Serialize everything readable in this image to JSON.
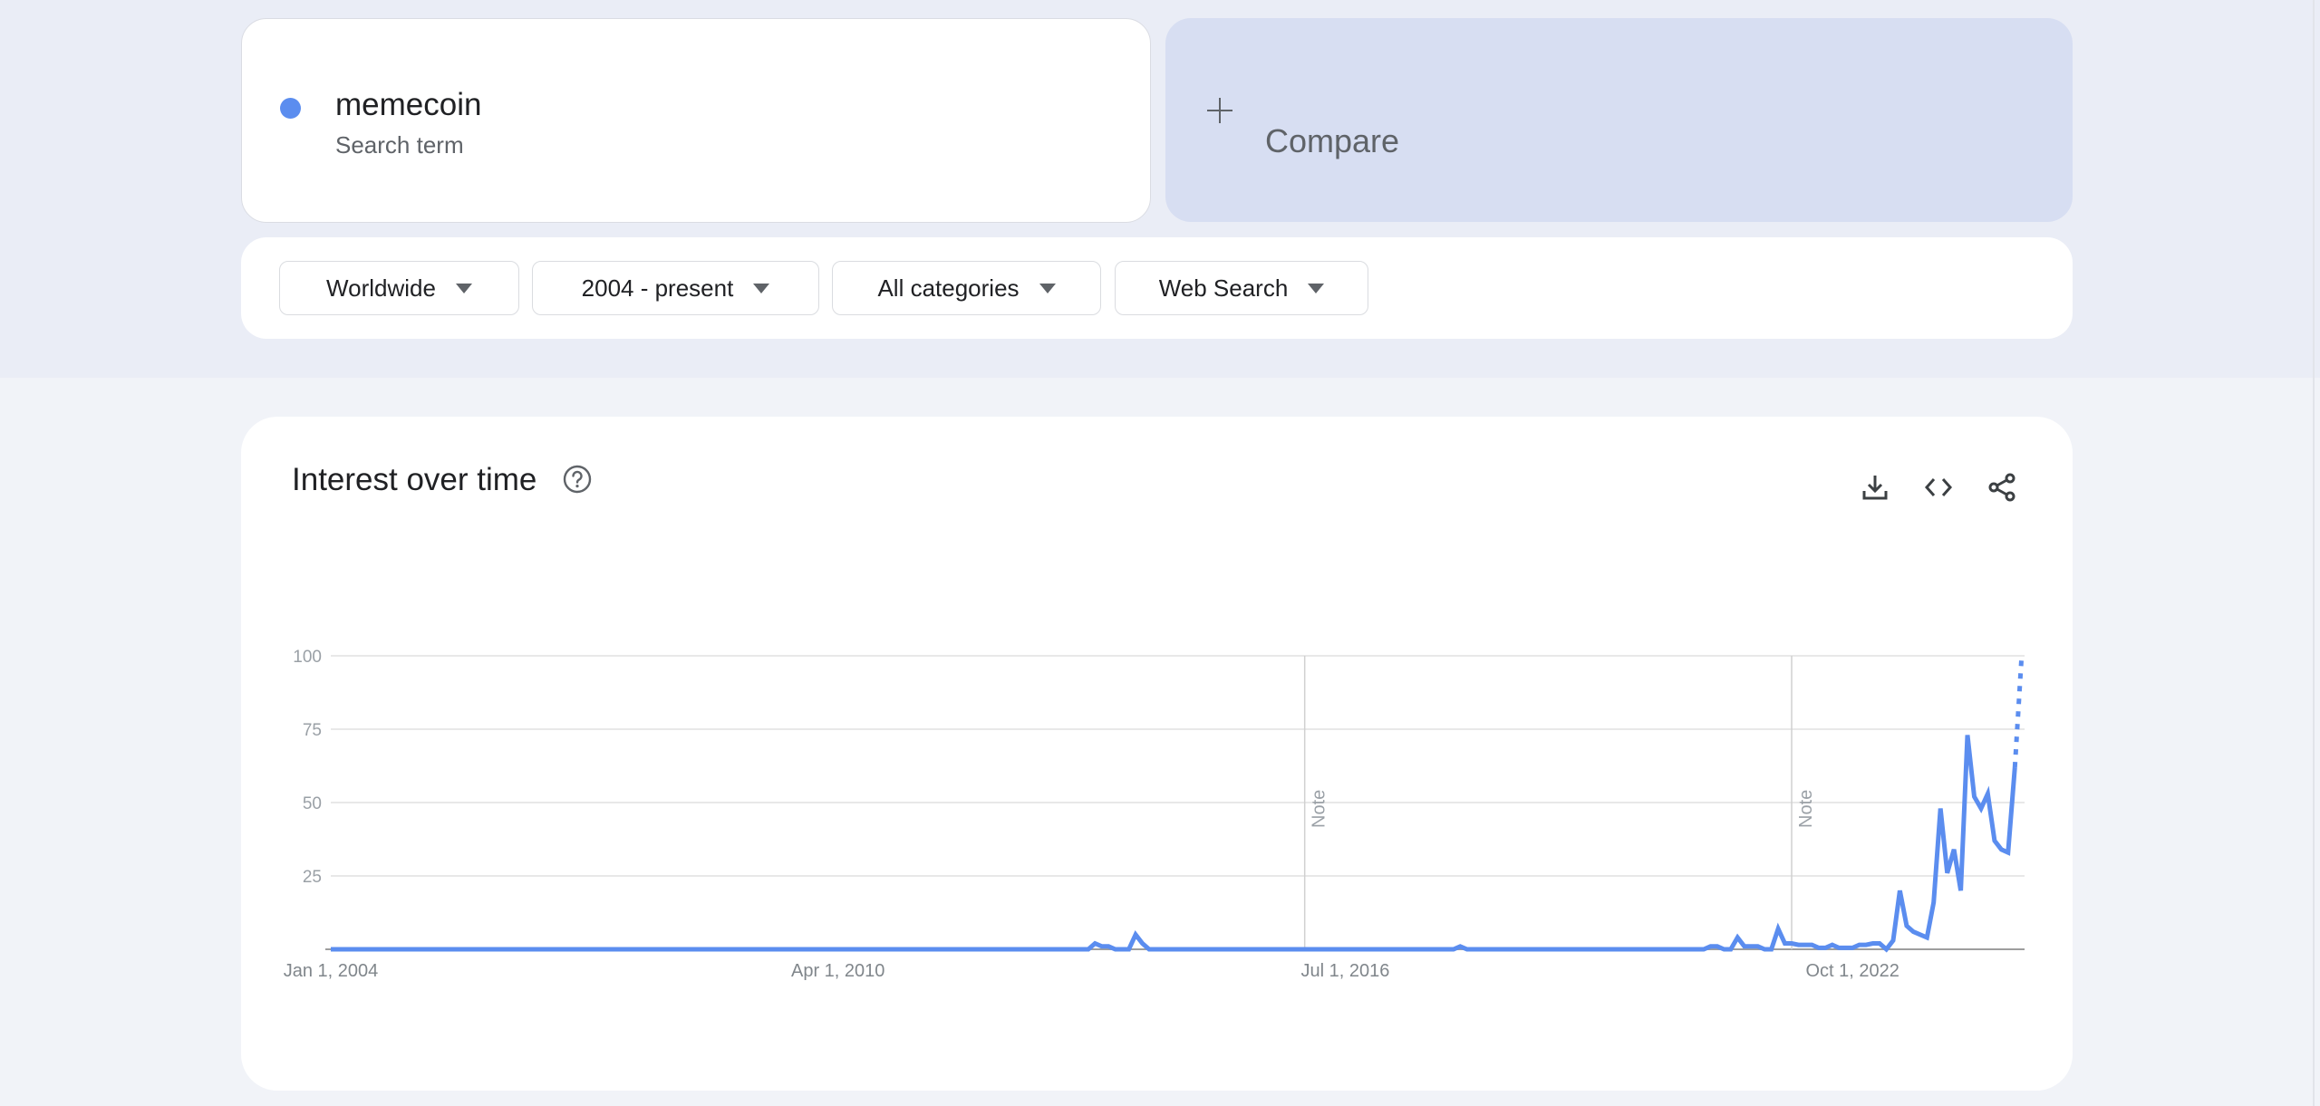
{
  "search_term": {
    "name": "memecoin",
    "subtitle": "Search term",
    "color": "#5b8def"
  },
  "compare": {
    "label": "Compare",
    "icon": "plus-icon"
  },
  "filters": [
    {
      "label": "Worldwide",
      "icon": "caret-down-icon"
    },
    {
      "label": "2004 - present",
      "icon": "caret-down-icon"
    },
    {
      "label": "All categories",
      "icon": "caret-down-icon"
    },
    {
      "label": "Web Search",
      "icon": "caret-down-icon"
    }
  ],
  "panel": {
    "title": "Interest over time",
    "help_icon": "help-circle-icon",
    "actions": [
      "download-icon",
      "embed-code-icon",
      "share-icon"
    ]
  },
  "chart_data": {
    "type": "line",
    "title": "Interest over time",
    "xlabel": "",
    "ylabel": "",
    "x_start": "Jan 2004",
    "x_step": "month",
    "x_ticks": [
      {
        "label": "Jan 1, 2004",
        "index": 0
      },
      {
        "label": "Apr 1, 2010",
        "index": 75
      },
      {
        "label": "Jul 1, 2016",
        "index": 150
      },
      {
        "label": "Oct 1, 2022",
        "index": 225
      }
    ],
    "y_ticks": [
      25,
      50,
      75,
      100
    ],
    "ylim": [
      0,
      100
    ],
    "grid": true,
    "notes": [
      {
        "label": "Note",
        "index": 144
      },
      {
        "label": "Note",
        "index": 216
      }
    ],
    "series": [
      {
        "name": "memecoin",
        "color": "#5b8def",
        "nonzero": {
          "113": 2,
          "114": 1,
          "115": 1,
          "119": 5,
          "120": 2,
          "167": 1,
          "204": 1,
          "205": 1,
          "208": 4,
          "209": 1,
          "210": 1,
          "211": 1,
          "214": 7,
          "215": 2,
          "216": 2,
          "217": 1.5,
          "218": 1.5,
          "219": 1.5,
          "220": 0.5,
          "221": 0.5,
          "222": 1.5,
          "223": 0.5,
          "224": 0.5,
          "225": 0.5,
          "226": 1.5,
          "227": 1.5,
          "228": 2,
          "229": 2,
          "230": 0,
          "231": 3,
          "232": 20,
          "233": 8,
          "234": 6,
          "235": 5,
          "236": 4,
          "237": 16,
          "238": 48,
          "239": 26,
          "240": 34,
          "241": 20,
          "242": 73,
          "243": 52,
          "244": 48,
          "245": 53,
          "246": 37,
          "247": 34,
          "248": 33,
          "249": 62,
          "250": 100
        },
        "length": 251,
        "partial_from_index": 249
      }
    ]
  }
}
